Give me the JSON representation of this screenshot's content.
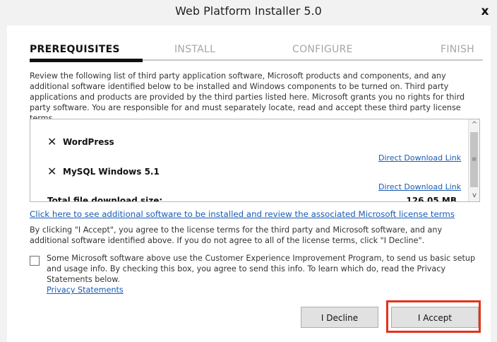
{
  "window": {
    "title": "Web Platform Installer 5.0",
    "close_glyph": "x"
  },
  "tabs": [
    {
      "label": "PREREQUISITES",
      "active": true
    },
    {
      "label": "INSTALL",
      "active": false
    },
    {
      "label": "CONFIGURE",
      "active": false
    },
    {
      "label": "FINISH",
      "active": false
    }
  ],
  "intro_text": "Review the following list of third party application software, Microsoft products and components, and any additional software identified below to be installed and Windows components to be turned on.  Third party applications and products are provided by the third parties listed here.  Microsoft grants you no rights for third party software.  You are responsible for and must separately locate, read and accept these third party license terms.",
  "items": [
    {
      "x_glyph": "✕",
      "name": "WordPress",
      "link": "Direct Download Link"
    },
    {
      "x_glyph": "✕",
      "name": "MySQL Windows 5.1",
      "link": "Direct Download Link"
    }
  ],
  "total": {
    "label": "Total file download size:",
    "size": "126.05 MB"
  },
  "scroll_glyphs": {
    "up": "^",
    "down": "v",
    "grip": "≡"
  },
  "more_link": "Click here to see additional software to be installed and review the associated Microsoft license terms",
  "accept_note": "By clicking \"I Accept\", you agree to the license terms for the third party and Microsoft software, and any additional software identified above.  If you do not agree to all of the license terms, click \"I Decline\".",
  "ceip": {
    "checked": false,
    "text": "Some Microsoft software above use the Customer Experience Improvement Program, to send us basic setup and usage info.  By checking this box, you agree to send this info.  To learn which do, read the Privacy Statements below.",
    "link": "Privacy Statements"
  },
  "buttons": {
    "decline": "I Decline",
    "accept": "I Accept"
  },
  "colors": {
    "link": "#1a5bb5",
    "highlight": "#e5331a",
    "button_bg": "#e1e1e1"
  }
}
